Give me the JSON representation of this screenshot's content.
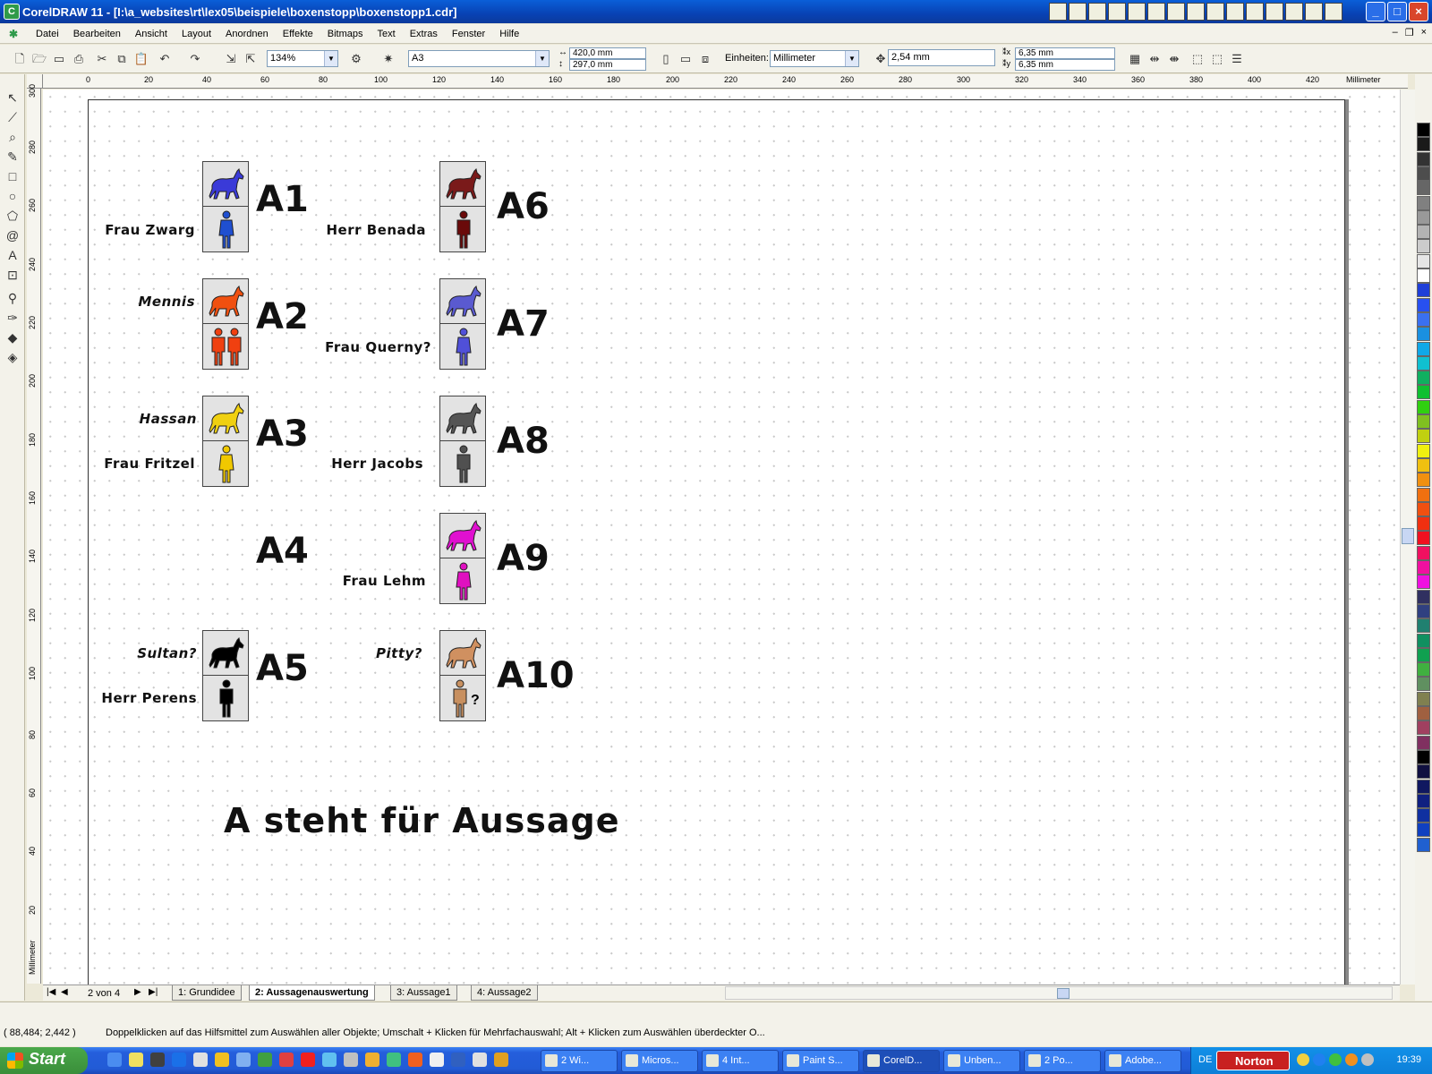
{
  "window": {
    "title": "CorelDRAW 11 - [I:\\a_websites\\rt\\lex05\\beispiele\\boxenstopp\\boxenstopp1.cdr]"
  },
  "menu": [
    "Datei",
    "Bearbeiten",
    "Ansicht",
    "Layout",
    "Anordnen",
    "Effekte",
    "Bitmaps",
    "Text",
    "Extras",
    "Fenster",
    "Hilfe"
  ],
  "toolbar": {
    "zoom": "134%",
    "paper": "A3",
    "width": "420,0 mm",
    "height": "297,0 mm",
    "units_label": "Einheiten:",
    "units": "Millimeter",
    "nudge": "2,54 mm",
    "dup_x": "6,35 mm",
    "dup_y": "6,35 mm"
  },
  "ruler": {
    "unit": "Millimeter",
    "h_ticks": [
      "0",
      "20",
      "40",
      "60",
      "80",
      "100",
      "120",
      "140",
      "160",
      "180",
      "200",
      "220",
      "240",
      "260",
      "280",
      "300",
      "320",
      "340",
      "360",
      "380",
      "400",
      "420"
    ],
    "v_ticks": [
      "300",
      "280",
      "260",
      "240",
      "220",
      "200",
      "180",
      "160",
      "140",
      "120",
      "100",
      "80",
      "60",
      "40",
      "20"
    ]
  },
  "drawing": {
    "boxes": [
      {
        "id": "A1",
        "horse_color": "#3a3ad8",
        "person_color": "#1f4fd0",
        "person_type": "female",
        "label_top": "",
        "label_bottom": "Frau Zwarg"
      },
      {
        "id": "A2",
        "horse_color": "#f05010",
        "person_color": "#f04010",
        "person_type": "couple",
        "label_top": "Mennis",
        "label_bottom": ""
      },
      {
        "id": "A3",
        "horse_color": "#f0d010",
        "person_color": "#f0c800",
        "person_type": "female",
        "label_top": "Hassan",
        "label_bottom": "Frau Fritzel"
      },
      {
        "id": "A4",
        "horse_color": "",
        "person_color": "",
        "person_type": "none",
        "label_top": "",
        "label_bottom": ""
      },
      {
        "id": "A5",
        "horse_color": "#000000",
        "person_color": "#000000",
        "person_type": "male",
        "label_top": "Sultan?",
        "label_bottom": "Herr Perens"
      },
      {
        "id": "A6",
        "horse_color": "#7a1a1a",
        "person_color": "#6a0a0a",
        "person_type": "male",
        "label_top": "",
        "label_bottom": "Herr Benada"
      },
      {
        "id": "A7",
        "horse_color": "#5a5ad0",
        "person_color": "#5050d8",
        "person_type": "female",
        "label_top": "",
        "label_bottom": "Frau Querny?"
      },
      {
        "id": "A8",
        "horse_color": "#555555",
        "person_color": "#505050",
        "person_type": "male",
        "label_top": "",
        "label_bottom": "Herr Jacobs"
      },
      {
        "id": "A9",
        "horse_color": "#e010d0",
        "person_color": "#e010c0",
        "person_type": "female",
        "label_top": "",
        "label_bottom": "Frau Lehm"
      },
      {
        "id": "A10",
        "horse_color": "#d09060",
        "person_color": "#c89060",
        "person_type": "unknown",
        "label_top": "Pitty?",
        "label_bottom": ""
      }
    ],
    "legend": "A steht für Aussage"
  },
  "pages": {
    "counter": "2 von 4",
    "tabs": [
      "1: Grundidee",
      "2: Aussagenauswertung",
      "3: Aussage1",
      "4: Aussage2"
    ],
    "active": 1
  },
  "status": {
    "coords": "( 88,484; 2,442 )",
    "hint": "Doppelklicken auf das Hilfsmittel zum Auswählen aller Objekte; Umschalt + Klicken für Mehrfachauswahl; Alt + Klicken zum Auswählen überdeckter O..."
  },
  "taskbar": {
    "start": "Start",
    "tasks": [
      "2 Wi...",
      "Micros...",
      "4 Int...",
      "Paint S...",
      "CorelD...",
      "Unben...",
      "2 Po...",
      "Adobe..."
    ],
    "active_task": 4,
    "lang": "DE",
    "antivirus": "Norton",
    "clock": "19:39"
  },
  "palette": [
    "#000000",
    "#1a1a1a",
    "#333333",
    "#4d4d4d",
    "#666666",
    "#808080",
    "#999999",
    "#b3b3b3",
    "#cccccc",
    "#e6e6e6",
    "#ffffff",
    "#1f3fd8",
    "#2850f0",
    "#3a70f0",
    "#1a90e0",
    "#10a8e8",
    "#10c0d0",
    "#10b060",
    "#10c030",
    "#30d010",
    "#80c020",
    "#c0d010",
    "#f0f010",
    "#f0c010",
    "#f09010",
    "#f07010",
    "#f05010",
    "#f03010",
    "#f01020",
    "#f01060",
    "#f010a0",
    "#f010e0",
    "#303060",
    "#304080",
    "#208070",
    "#109060",
    "#10a050",
    "#40b040",
    "#609060",
    "#808050",
    "#a06040",
    "#a04060",
    "#803060",
    "#000000",
    "#101040",
    "#101860",
    "#102080",
    "#1030a0",
    "#1040c0",
    "#2060d0"
  ]
}
